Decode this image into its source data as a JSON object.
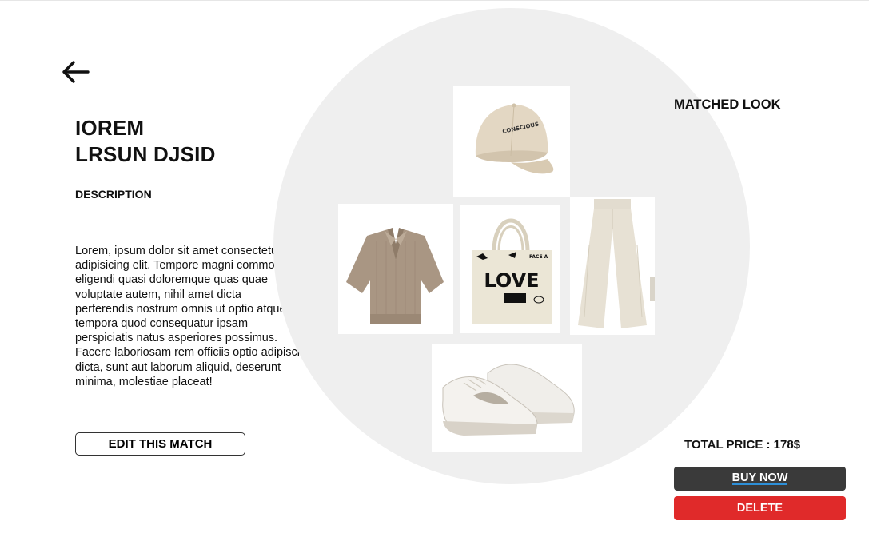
{
  "product": {
    "title_line1": "IOREM",
    "title_line2": "LRSUN DJSID",
    "description_heading": "DESCRIPTION",
    "description_text": "Lorem, ipsum dolor sit amet consectetur adipisicing elit. Tempore magni commodi eligendi quasi doloremque quas quae voluptate autem, nihil amet dicta perferendis nostrum omnis ut optio atque tempora quod consequatur ipsam perspiciatis natus asperiores possimus. Facere laboriosam rem officiis optio adipisci dicta, sunt aut laborum aliquid, deserunt minima, molestiae placeat!",
    "edit_button_label": "EDIT THIS MATCH"
  },
  "look": {
    "heading": "MATCHED LOOK",
    "items": [
      {
        "name": "cap",
        "print": "CONSCIOUS"
      },
      {
        "name": "polo-top"
      },
      {
        "name": "tote-bag",
        "print_main": "LOVE",
        "print_small": "FACE A"
      },
      {
        "name": "wide-pants"
      },
      {
        "name": "sneakers"
      }
    ]
  },
  "checkout": {
    "total_label": "TOTAL PRICE : 178$",
    "buy_label": "BUY NOW",
    "delete_label": "DELETE"
  },
  "colors": {
    "circle": "#efefef",
    "buy_button": "#3a3a3a",
    "delete_button": "#e02a2a",
    "link_underline": "#2d8fd8",
    "beige": "#e8e0d0",
    "taupe": "#a99683"
  },
  "icons": {
    "back": "arrow-left-icon"
  }
}
